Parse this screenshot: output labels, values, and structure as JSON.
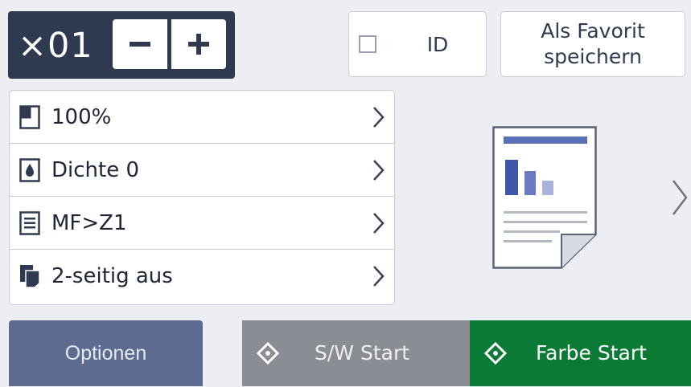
{
  "copies": {
    "value": "×01",
    "decrease_symbol": "−",
    "increase_symbol": "+"
  },
  "id_button": {
    "label": "ID",
    "checked": false
  },
  "favorite_button": {
    "line1": "Als Favorit",
    "line2": "speichern"
  },
  "settings": [
    {
      "icon": "page-size-icon",
      "label": "100%"
    },
    {
      "icon": "density-drop-icon",
      "label": "Dichte 0"
    },
    {
      "icon": "tray-list-icon",
      "label": "MF>Z1"
    },
    {
      "icon": "duplex-pages-icon",
      "label": "2-seitig aus"
    }
  ],
  "preview": {
    "icon": "document-preview-icon",
    "next_icon": "chevron-right-icon"
  },
  "bottom": {
    "options_label": "Optionen",
    "mono_start_label": "S/W Start",
    "color_start_label": "Farbe Start"
  },
  "colors": {
    "panel_dark": "#2f3a51",
    "options_bg": "#5c6b8f",
    "mono_start_bg": "#8a8d93",
    "color_start_bg": "#0b7a34",
    "screen_bg": "#eceef3",
    "preview_accent": "#5a6fb8"
  }
}
